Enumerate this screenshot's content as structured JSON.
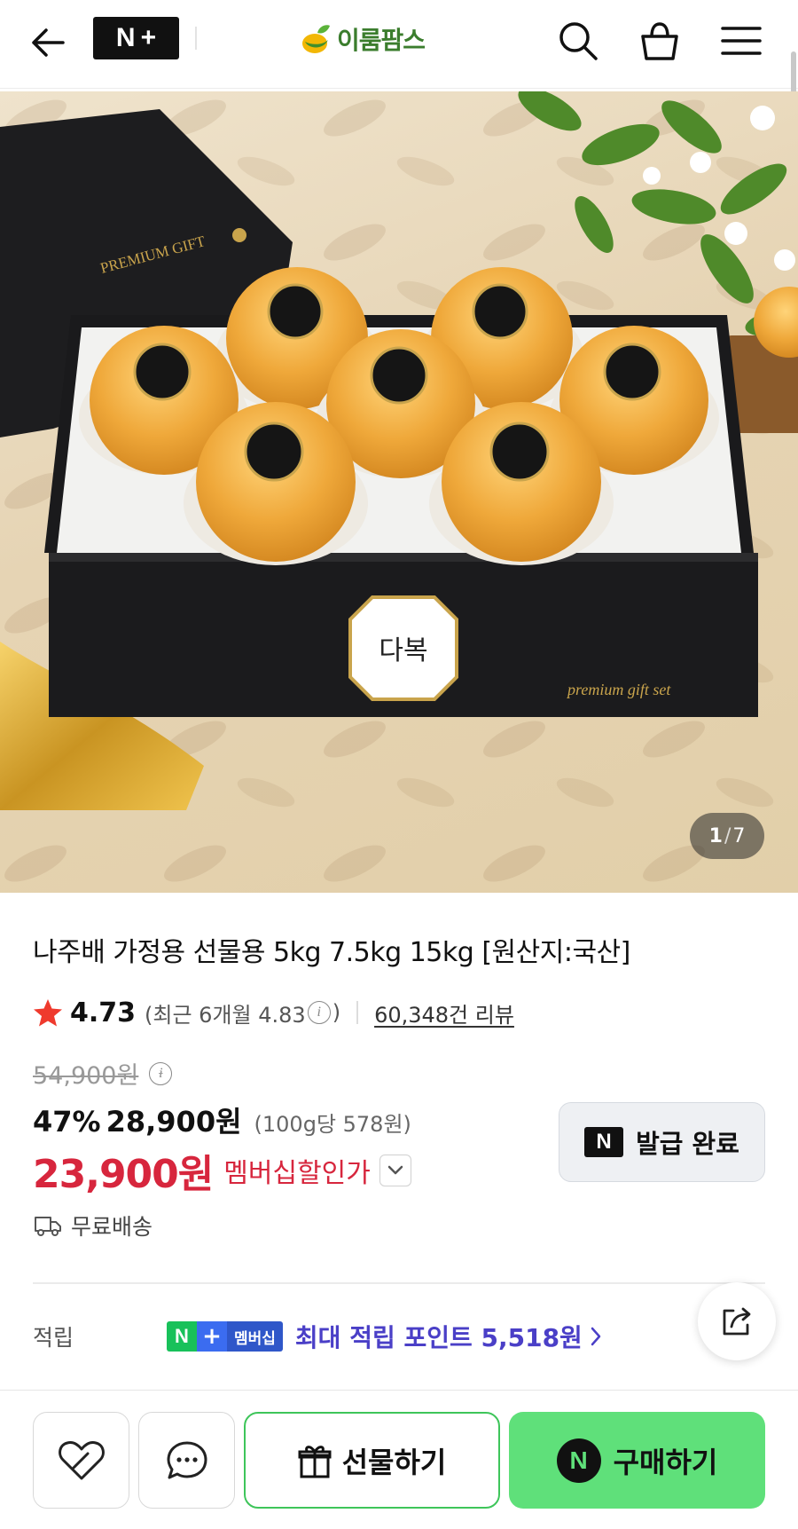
{
  "header": {
    "nplus_logo_n": "N",
    "nplus_logo_plus": "+",
    "brand_name": "이룸팜스"
  },
  "gallery": {
    "box_text_premium_gift": "PREMIUM GIFT",
    "box_label": "다복",
    "box_text_premium_gift_set": "premium gift set",
    "current": "1",
    "separator": "/",
    "total": "7"
  },
  "product": {
    "title": "나주배 가정용 선물용 5kg 7.5kg 15kg [원산지:국산]",
    "rating": "4.73",
    "recent_rating_text": "(최근 6개월 4.83",
    "recent_rating_close": ")",
    "review_count_text": "60,348건 리뷰",
    "original_price": "54,900원",
    "discount_rate": "47%",
    "sale_price": "28,900원",
    "unit_price": "(100g당 578원)",
    "member_price": "23,900원",
    "member_price_label": "멤버십할인가",
    "coupon_button_label": "발급 완료",
    "coupon_badge": "N",
    "shipping_label": "무료배송",
    "points_label": "적립",
    "points_badge_n": "N",
    "points_badge_plus": "+",
    "points_badge_member": "멤버십",
    "points_text": "최대 적립 포인트 5,518원"
  },
  "bottom_bar": {
    "gift_label": "선물하기",
    "buy_badge": "N",
    "buy_label": "구매하기"
  },
  "colors": {
    "accent_red": "#d7263d",
    "naver_green": "#5fe07a",
    "points_purple": "#4a3fc7"
  }
}
